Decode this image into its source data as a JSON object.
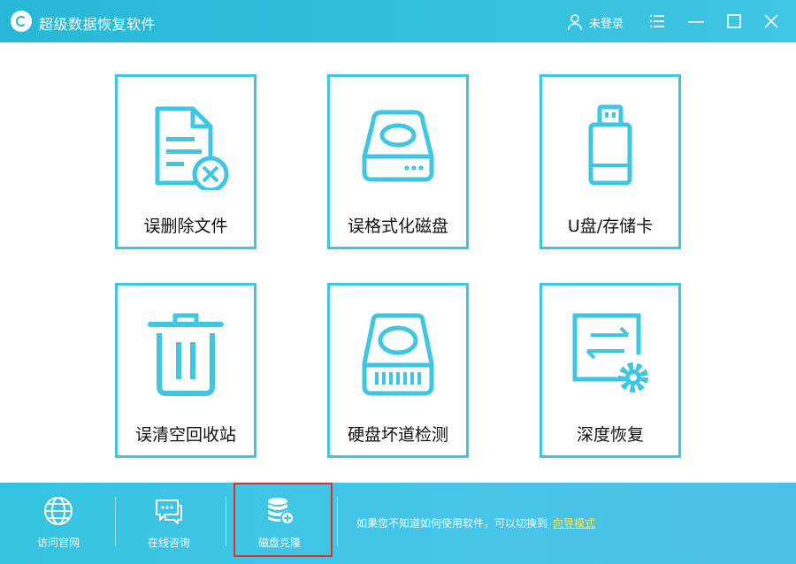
{
  "window": {
    "title": "超级数据恢复软件",
    "user_label": "未登录"
  },
  "tiles": [
    {
      "label": "误删除文件",
      "icon": "deleted-file-icon"
    },
    {
      "label": "误格式化磁盘",
      "icon": "disk-icon"
    },
    {
      "label": "U盘/存储卡",
      "icon": "usb-drive-icon"
    },
    {
      "label": "误清空回收站",
      "icon": "trash-icon"
    },
    {
      "label": "硬盘坏道检测",
      "icon": "hard-drive-icon"
    },
    {
      "label": "深度恢复",
      "icon": "deep-recovery-icon"
    }
  ],
  "bottom": {
    "items": [
      {
        "label": "访问官网",
        "icon": "globe-icon"
      },
      {
        "label": "在线咨询",
        "icon": "chat-icon"
      },
      {
        "label": "磁盘克隆",
        "icon": "database-clone-icon"
      }
    ],
    "hint_text": "如果您不知道如何使用软件，可以切换到",
    "hint_link": "向导模式"
  },
  "colors": {
    "accent": "#3ec6e3",
    "titlebar": "#27b8d8",
    "highlight_border": "#e0302a",
    "link": "#ffe84a"
  }
}
